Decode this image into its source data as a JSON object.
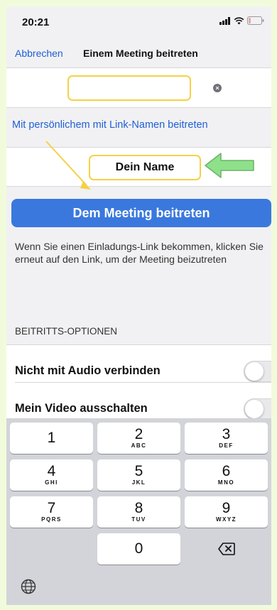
{
  "status_bar": {
    "time": "20:21"
  },
  "nav": {
    "cancel": "Abbrechen",
    "title": "Einem Meeting beitreten"
  },
  "meeting_id_input": {
    "value": "",
    "clear_icon": "x-circle-icon"
  },
  "link_name_label": "Mit persönlichem mit Link-Namen beitreten",
  "name_input": {
    "value": "Dein Name"
  },
  "join_button": "Dem Meeting beitreten",
  "hint_text": "Wenn Sie einen Einladungs-Link bekommen, klicken Sie erneut auf den Link, um der Meeting beizutreten",
  "options": {
    "header": "BEITRITTS-OPTIONEN",
    "items": [
      {
        "label": "Nicht mit Audio verbinden",
        "enabled": false
      },
      {
        "label": "Mein Video ausschalten",
        "enabled": false
      }
    ]
  },
  "keyboard": {
    "keys": [
      {
        "digit": "1",
        "letters": ""
      },
      {
        "digit": "2",
        "letters": "ABC"
      },
      {
        "digit": "3",
        "letters": "DEF"
      },
      {
        "digit": "4",
        "letters": "GHI"
      },
      {
        "digit": "5",
        "letters": "JKL"
      },
      {
        "digit": "6",
        "letters": "MNO"
      },
      {
        "digit": "7",
        "letters": "PQRS"
      },
      {
        "digit": "8",
        "letters": "TUV"
      },
      {
        "digit": "9",
        "letters": "WXYZ"
      },
      {
        "digit": "0",
        "letters": ""
      }
    ]
  },
  "colors": {
    "accent": "#3a78de",
    "link": "#1f5fd6",
    "highlight": "#f4d146",
    "arrow_green": "#8fe08a",
    "frame": "#f1fbdc"
  }
}
